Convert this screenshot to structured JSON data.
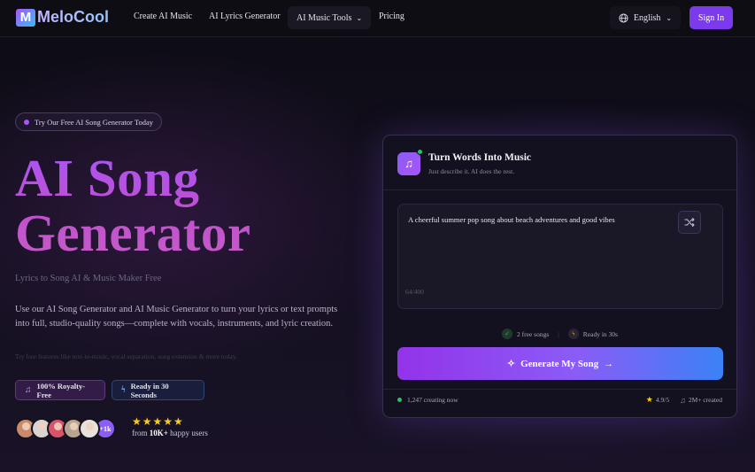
{
  "nav": {
    "logo_text": "MeloCool",
    "logo_mark": "M",
    "links": [
      "Create AI Music",
      "AI Lyrics Generator",
      "AI Music Tools",
      "Pricing"
    ],
    "language": "English",
    "sign_in": "Sign In"
  },
  "hero": {
    "badge": "Try Our Free AI Song Generator Today",
    "title_line1": "AI Song",
    "title_line2": "Generator",
    "subtitle": "Lyrics to Song AI & Music Maker Free",
    "description": "Use our AI Song Generator and AI Music Generator to turn your lyrics or text prompts into full, studio-quality songs—complete with vocals, instruments, and lyric creation.",
    "hint": "Try free features like text-to-music, vocal separation, song extension & more today.",
    "chip_royalty": "100% Royalty-Free",
    "chip_ready": "Ready in 30 Seconds",
    "avatars_more": "+1k",
    "stars": "★★★★★",
    "users_prefix": "from ",
    "users_count": "10K+",
    "users_suffix": " happy users"
  },
  "card": {
    "title": "Turn Words Into Music",
    "subtitle": "Just describe it. AI does the rest.",
    "prompt_text": "A cheerful summer pop song about beach adventures and good vibes",
    "char_count": "64/400",
    "free_songs": "2 free songs",
    "ready": "Ready in 30s",
    "generate": "Generate My Song",
    "creating_now": "1,247 creating now",
    "rating": "4.9/5",
    "created": "2M+ created"
  },
  "colors": {
    "accent": "#7c3aed",
    "online": "#22c55e",
    "star": "#facc15",
    "avatars": [
      "#c98a6b",
      "#d9d4cf",
      "#d9536a",
      "#b7a58f",
      "#e8e2dc"
    ]
  }
}
